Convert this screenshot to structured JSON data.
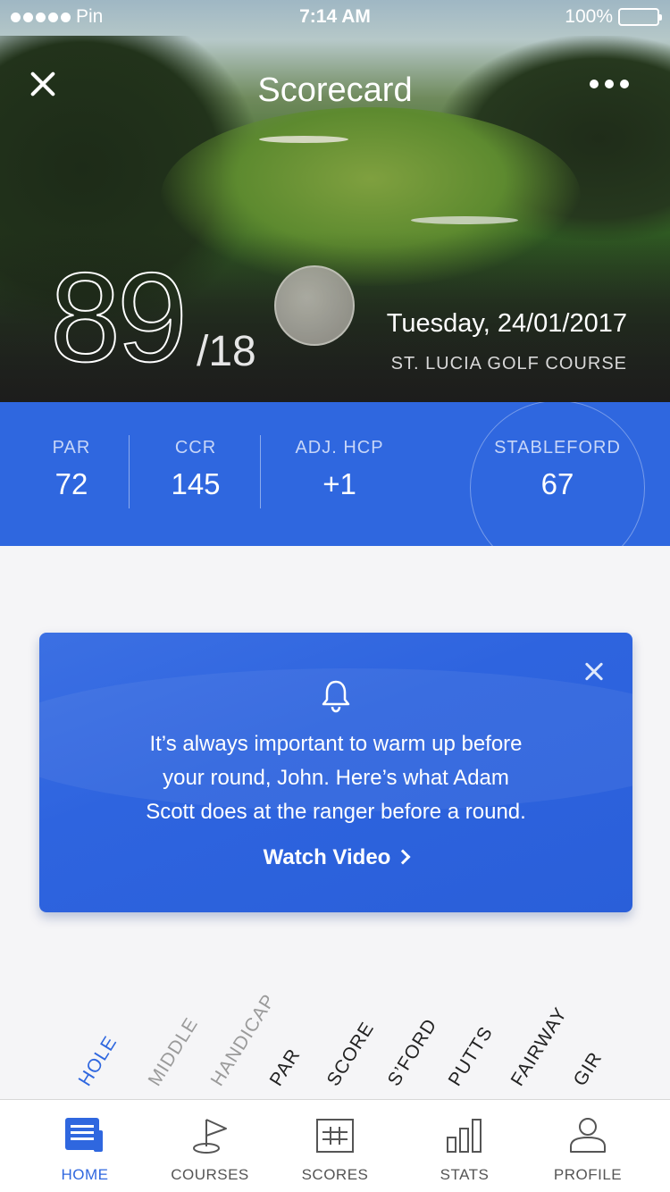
{
  "status_bar": {
    "carrier": "Pin",
    "time": "7:14 AM",
    "battery": "100%"
  },
  "header": {
    "title": "Scorecard"
  },
  "round": {
    "score": "89",
    "holes": "/18",
    "date": "Tuesday, 24/01/2017",
    "course": "ST. LUCIA GOLF COURSE"
  },
  "stats": [
    {
      "label": "PAR",
      "value": "72"
    },
    {
      "label": "CCR",
      "value": "145"
    },
    {
      "label": "ADJ. HCP",
      "value": "+1"
    },
    {
      "label": "STABLEFORD",
      "value": "67"
    }
  ],
  "notice": {
    "line1": "It’s always important to warm up before",
    "line2": "your round, John. Here’s what Adam",
    "line3": "Scott does at the ranger before a round.",
    "action": "Watch Video"
  },
  "columns": [
    "HOLE",
    "MIDDLE",
    "HANDICAP",
    "PAR",
    "SCORE",
    "S’FORD",
    "PUTTS",
    "FAIRWAY",
    "GIR"
  ],
  "tabs": [
    {
      "label": "HOME",
      "icon": "home-icon"
    },
    {
      "label": "COURSES",
      "icon": "flag-icon"
    },
    {
      "label": "SCORES",
      "icon": "scorecard-icon"
    },
    {
      "label": "STATS",
      "icon": "bar-chart-icon"
    },
    {
      "label": "PROFILE",
      "icon": "user-icon"
    }
  ],
  "colors": {
    "accent": "#2f67df",
    "card": "#2e64df",
    "active_tab": "#2f67df"
  }
}
